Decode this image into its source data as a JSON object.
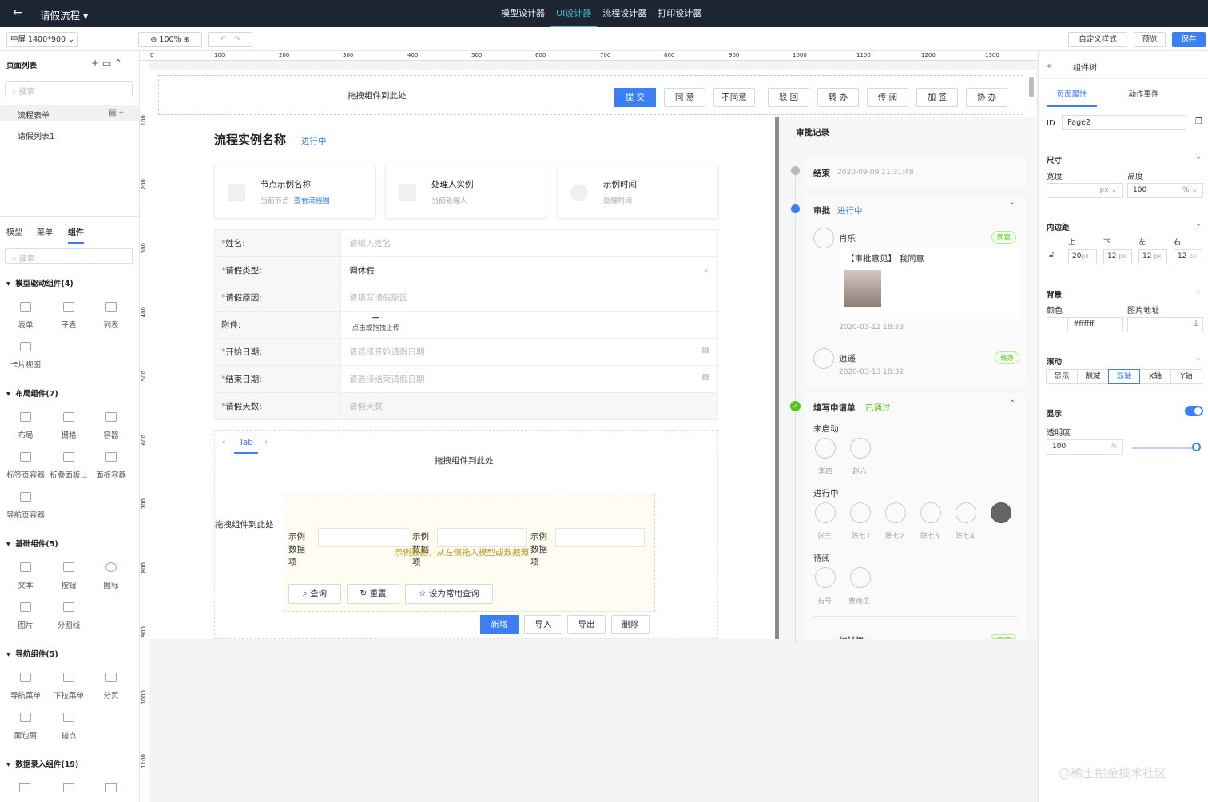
{
  "topbar": {
    "title": "请假流程",
    "nav": [
      "模型设计器",
      "UI设计器",
      "流程设计器",
      "打印设计器"
    ]
  },
  "toolbar": {
    "screen": "中屏 1400*900",
    "zoom": "100%",
    "custom_style": "自定义样式",
    "preview": "预览",
    "save": "保存"
  },
  "left": {
    "title": "页面列表",
    "search": "搜索",
    "pages": [
      "流程表单",
      "请假列表1"
    ],
    "tabs": [
      "模型",
      "菜单",
      "组件"
    ],
    "search2": "搜索",
    "groups": [
      {
        "name": "模型驱动组件(4)",
        "items": [
          "表单",
          "子表",
          "列表",
          "卡片视图"
        ]
      },
      {
        "name": "布局组件(7)",
        "items": [
          "布局",
          "栅格",
          "容器",
          "标签页容器",
          "折叠面板...",
          "面板容器",
          "导航页容器"
        ]
      },
      {
        "name": "基础组件(5)",
        "items": [
          "文本",
          "按钮",
          "图标",
          "图片",
          "分割线"
        ]
      },
      {
        "name": "导航组件(5)",
        "items": [
          "导航菜单",
          "下拉菜单",
          "分页",
          "面包屑",
          "锚点"
        ]
      },
      {
        "name": "数据录入组件(19)",
        "items": []
      }
    ]
  },
  "ruler": {
    "h": [
      "0",
      "100",
      "200",
      "300",
      "400",
      "500",
      "600",
      "700",
      "800",
      "900",
      "1000",
      "1100",
      "1200",
      "1300"
    ],
    "v": [
      "100",
      "200",
      "300",
      "400",
      "500",
      "600",
      "700",
      "800",
      "900",
      "1000",
      "1100"
    ]
  },
  "canvas": {
    "drop_hint": "拖拽组件到此处",
    "actions": [
      "提 交",
      "同 意",
      "不同意",
      "驳 回",
      "转 办",
      "传 阅",
      "加 签",
      "协 办"
    ],
    "heading": "流程实例名称",
    "status": "进行中",
    "cards": [
      {
        "title": "节点示例名称",
        "sub": "当前节点",
        "link": "查看流程图"
      },
      {
        "title": "处理人实例",
        "sub": "当前处理人",
        "link": ""
      },
      {
        "title": "示例时间",
        "sub": "处理时间",
        "link": ""
      }
    ],
    "fields": [
      {
        "label": "姓名:",
        "value": "请输入姓名",
        "req": "*"
      },
      {
        "label": "请假类型:",
        "value": "调休假",
        "req": "*"
      },
      {
        "label": "请假原因:",
        "value": "请填写请假原因",
        "req": "*"
      },
      {
        "label": "附件:",
        "value": "点击或拖拽上传",
        "req": ""
      },
      {
        "label": "开始日期:",
        "value": "请选择开始请假日期",
        "req": "*"
      },
      {
        "label": "结束日期:",
        "value": "请选择结束请假日期",
        "req": "*"
      },
      {
        "label": "请假天数:",
        "value": "请假天数",
        "req": "*"
      }
    ],
    "tab_label": "Tab",
    "tab_drop": "拖拽组件到此处",
    "left_drop": "拖拽组件到此处",
    "query_labels": [
      "示例数据项",
      "示例数据项",
      "示例数据项"
    ],
    "query_hint": "示例数据，从左侧拖入模型或数据源",
    "query_btns": [
      "查询",
      "重置",
      "设为常用查询"
    ],
    "list_btns": [
      "新增",
      "导入",
      "导出",
      "删除"
    ]
  },
  "approval": {
    "title": "审批记录",
    "end": {
      "label": "结束",
      "time": "2020-09-09 11:31:48"
    },
    "approve": {
      "label": "审批",
      "status": "进行中"
    },
    "r1": {
      "name": "肖乐",
      "tag": "同意",
      "opinion": "【审批意见】 我同意",
      "time": "2020-03-12 18:33"
    },
    "r2": {
      "name": "逍遥",
      "tag": "转办",
      "time": "2020-03-13 18:32"
    },
    "fill": {
      "label": "填写申请单",
      "status": "已通过"
    },
    "not_started": "未启动",
    "ns_people": [
      "李四",
      "赵六"
    ],
    "in_progress": "进行中",
    "ip_people": [
      "张三",
      "陈七1",
      "陈七2",
      "陈七3",
      "陈七4"
    ],
    "to_read": "待阅",
    "tr_people": [
      "石号",
      "曹雨生"
    ],
    "partial": "伊轻舞",
    "partial_tag": "已阅"
  },
  "right": {
    "title": "组件树",
    "tabs": [
      "页面属性",
      "动作事件"
    ],
    "id_label": "ID",
    "id_value": "Page2",
    "size": "尺寸",
    "width": "宽度",
    "height": "高度",
    "w_unit": "px",
    "h_value": "100",
    "h_unit": "%",
    "padding": "内边距",
    "pads": [
      "上",
      "下",
      "左",
      "右"
    ],
    "pad_vals": [
      "20",
      "12",
      "12",
      "12"
    ],
    "pad_unit": "px",
    "bg": "背景",
    "color": "颜色",
    "img": "图片地址",
    "color_val": "#ffffff",
    "scroll": "滚动",
    "scroll_opts": [
      "显示",
      "削减",
      "双轴",
      "X轴",
      "Y轴"
    ],
    "display": "显示",
    "opacity": "透明度",
    "opacity_val": "100",
    "opacity_unit": "%"
  },
  "watermark": "@稀土掘金技术社区"
}
